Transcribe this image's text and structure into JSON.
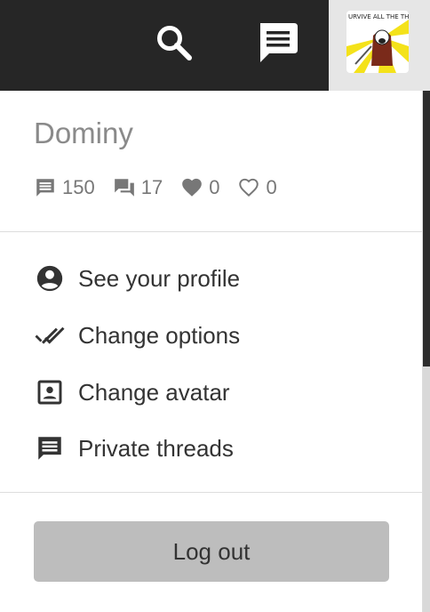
{
  "topbar": {
    "search_icon": "search-icon",
    "threads_icon": "private-threads-icon",
    "avatar_caption": "URVIVE ALL THE THINGS!"
  },
  "user": {
    "name": "Dominy"
  },
  "stats": [
    {
      "icon": "posts-icon",
      "value": "150"
    },
    {
      "icon": "threads-icon",
      "value": "17"
    },
    {
      "icon": "likes-received-icon",
      "value": "0"
    },
    {
      "icon": "likes-given-icon",
      "value": "0"
    }
  ],
  "menu": {
    "profile": "See your profile",
    "options": "Change options",
    "avatar": "Change avatar",
    "threads": "Private threads"
  },
  "logout_label": "Log out",
  "colors": {
    "topbar": "#262626",
    "button": "#bdbdbd",
    "text": "#333333",
    "muted": "#8a8a8a"
  }
}
